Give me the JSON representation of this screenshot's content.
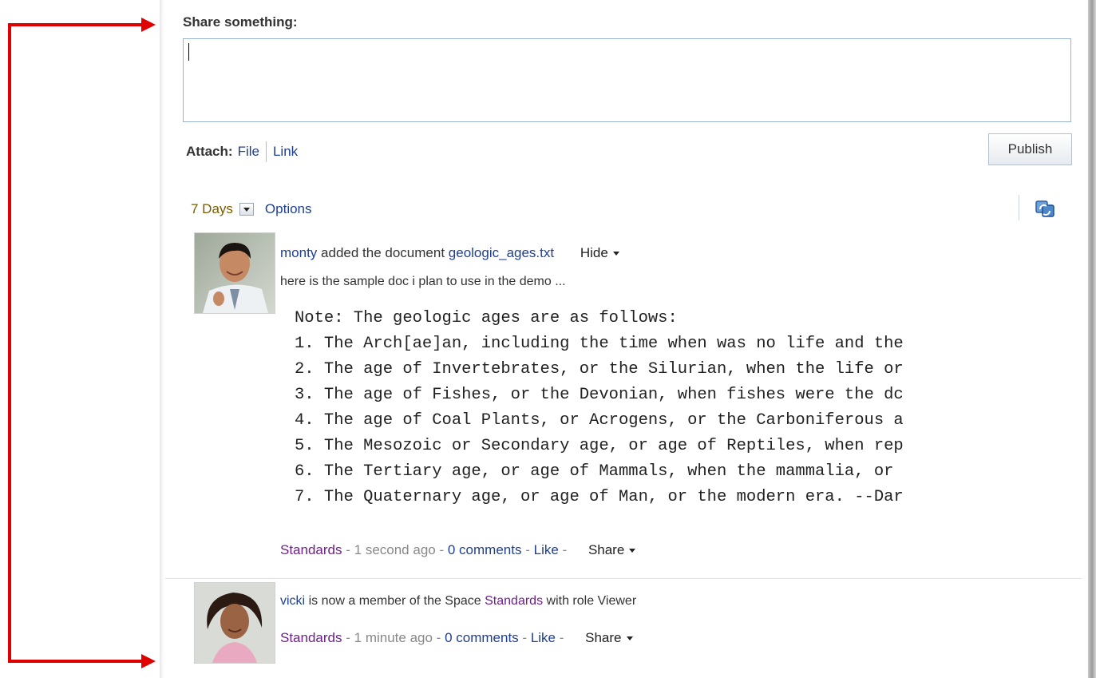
{
  "composer": {
    "label": "Share something:",
    "value": "",
    "attach_label": "Attach:",
    "attach_file": "File",
    "attach_link": "Link",
    "publish": "Publish"
  },
  "filter": {
    "days": "7 Days",
    "options": "Options"
  },
  "activities": [
    {
      "user": "monty",
      "action": "added the document",
      "document": "geologic_ages.txt",
      "hide": "Hide",
      "description": "here is the sample doc i plan to use in the demo ...",
      "preview_lines": [
        "Note: The geologic ages are as follows:",
        "1. The Arch[ae]an, including the time when was no life and the",
        "2. The age of Invertebrates, or the Silurian, when the life or",
        "3. The age of Fishes, or the Devonian, when fishes were the dc",
        "4. The age of Coal Plants, or Acrogens, or the Carboniferous a",
        "5. The Mesozoic or Secondary age, or age of Reptiles, when rep",
        "6. The Tertiary age, or age of Mammals, when the mammalia, or",
        "7. The Quaternary age, or age of Man, or the modern era. --Dar"
      ],
      "footer": {
        "space": "Standards",
        "sep": "-",
        "time": "1 second ago",
        "comments": "0 comments",
        "like": "Like",
        "share": "Share"
      }
    },
    {
      "user": "vicki",
      "text_before": "is now a member of the Space",
      "space": "Standards",
      "text_after": "with role Viewer",
      "footer": {
        "space": "Standards",
        "sep": "-",
        "time": "1 minute ago",
        "comments": "0 comments",
        "like": "Like",
        "share": "Share"
      }
    }
  ],
  "colors": {
    "annotation": "#e00000",
    "link": "#1f3f8f",
    "space_link": "#6e1f8a",
    "days": "#7a5b00"
  },
  "icons": [
    "refresh-icon",
    "dropdown-arrow-icon",
    "chevron-down-icon"
  ]
}
